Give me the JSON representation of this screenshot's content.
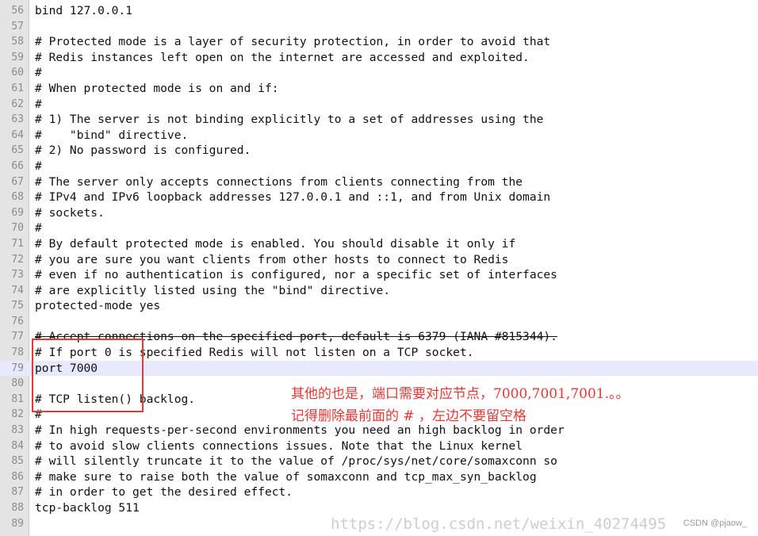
{
  "editor": {
    "current_line": "79",
    "lines": [
      {
        "num": "56",
        "text": "bind 127.0.0.1"
      },
      {
        "num": "57",
        "text": ""
      },
      {
        "num": "58",
        "text": "# Protected mode is a layer of security protection, in order to avoid that"
      },
      {
        "num": "59",
        "text": "# Redis instances left open on the internet are accessed and exploited."
      },
      {
        "num": "60",
        "text": "#"
      },
      {
        "num": "61",
        "text": "# When protected mode is on and if:"
      },
      {
        "num": "62",
        "text": "#"
      },
      {
        "num": "63",
        "text": "# 1) The server is not binding explicitly to a set of addresses using the"
      },
      {
        "num": "64",
        "text": "#    \"bind\" directive."
      },
      {
        "num": "65",
        "text": "# 2) No password is configured."
      },
      {
        "num": "66",
        "text": "#"
      },
      {
        "num": "67",
        "text": "# The server only accepts connections from clients connecting from the"
      },
      {
        "num": "68",
        "text": "# IPv4 and IPv6 loopback addresses 127.0.0.1 and ::1, and from Unix domain"
      },
      {
        "num": "69",
        "text": "# sockets."
      },
      {
        "num": "70",
        "text": "#"
      },
      {
        "num": "71",
        "text": "# By default protected mode is enabled. You should disable it only if"
      },
      {
        "num": "72",
        "text": "# you are sure you want clients from other hosts to connect to Redis"
      },
      {
        "num": "73",
        "text": "# even if no authentication is configured, nor a specific set of interfaces"
      },
      {
        "num": "74",
        "text": "# are explicitly listed using the \"bind\" directive."
      },
      {
        "num": "75",
        "text": "protected-mode yes"
      },
      {
        "num": "76",
        "text": ""
      },
      {
        "num": "77",
        "text": "# Accept connections on the specified port, default is 6379 (IANA #815344)."
      },
      {
        "num": "78",
        "text": "# If port 0 is specified Redis will not listen on a TCP socket."
      },
      {
        "num": "79",
        "text": "port 7000"
      },
      {
        "num": "80",
        "text": ""
      },
      {
        "num": "81",
        "text": "# TCP listen() backlog."
      },
      {
        "num": "82",
        "text": "#"
      },
      {
        "num": "83",
        "text": "# In high requests-per-second environments you need an high backlog in order"
      },
      {
        "num": "84",
        "text": "# to avoid slow clients connections issues. Note that the Linux kernel"
      },
      {
        "num": "85",
        "text": "# will silently truncate it to the value of /proc/sys/net/core/somaxconn so"
      },
      {
        "num": "86",
        "text": "# make sure to raise both the value of somaxconn and tcp_max_syn_backlog"
      },
      {
        "num": "87",
        "text": "# in order to get the desired effect."
      },
      {
        "num": "88",
        "text": "tcp-backlog 511"
      },
      {
        "num": "89",
        "text": ""
      }
    ]
  },
  "annotation": {
    "line1": "其他的也是，端口需要对应节点，7000,7001,7001.。。",
    "line2": "记得删除最前面的 #  ，左边不要留空格",
    "color": "#e53935"
  },
  "watermark": {
    "url": "https://blog.csdn.net/weixin_40274495",
    "tag": "CSDN @pjaow_"
  }
}
